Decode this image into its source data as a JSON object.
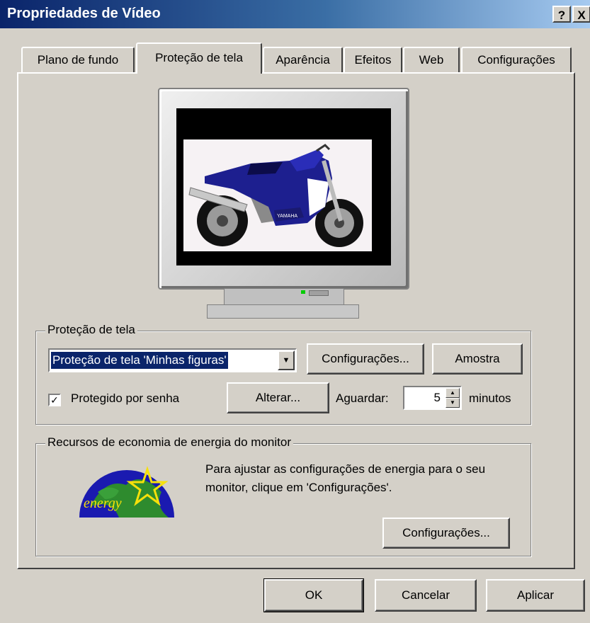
{
  "window": {
    "title": "Propriedades de Vídeo",
    "help_button": "?",
    "close_button": "X"
  },
  "tabs": [
    {
      "label": "Plano de fundo",
      "active": false
    },
    {
      "label": "Proteção de tela",
      "active": true
    },
    {
      "label": "Aparência",
      "active": false
    },
    {
      "label": "Efeitos",
      "active": false
    },
    {
      "label": "Web",
      "active": false
    },
    {
      "label": "Configurações",
      "active": false
    }
  ],
  "preview": {
    "image": "motorcycle-photo",
    "brand_on_bike": "YAMAHA"
  },
  "screensaver": {
    "group_label": "Proteção de tela",
    "selected": "Proteção de tela 'Minhas figuras'",
    "settings_button": "Configurações...",
    "preview_button": "Amostra",
    "password_checked": true,
    "password_label": "Protegido por senha",
    "change_button": "Alterar...",
    "wait_label": "Aguardar:",
    "wait_value": "5",
    "minutes_label": "minutos"
  },
  "energy": {
    "group_label": "Recursos de economia de energia do monitor",
    "description": "Para ajustar as configurações de energia para o seu monitor, clique em 'Configurações'.",
    "logo_text": "energy",
    "settings_button": "Configurações..."
  },
  "footer": {
    "ok": "OK",
    "cancel": "Cancelar",
    "apply": "Aplicar"
  },
  "colors": {
    "titlebar": "#0a246a",
    "face": "#d4d0c8",
    "selection": "#0a246a"
  }
}
